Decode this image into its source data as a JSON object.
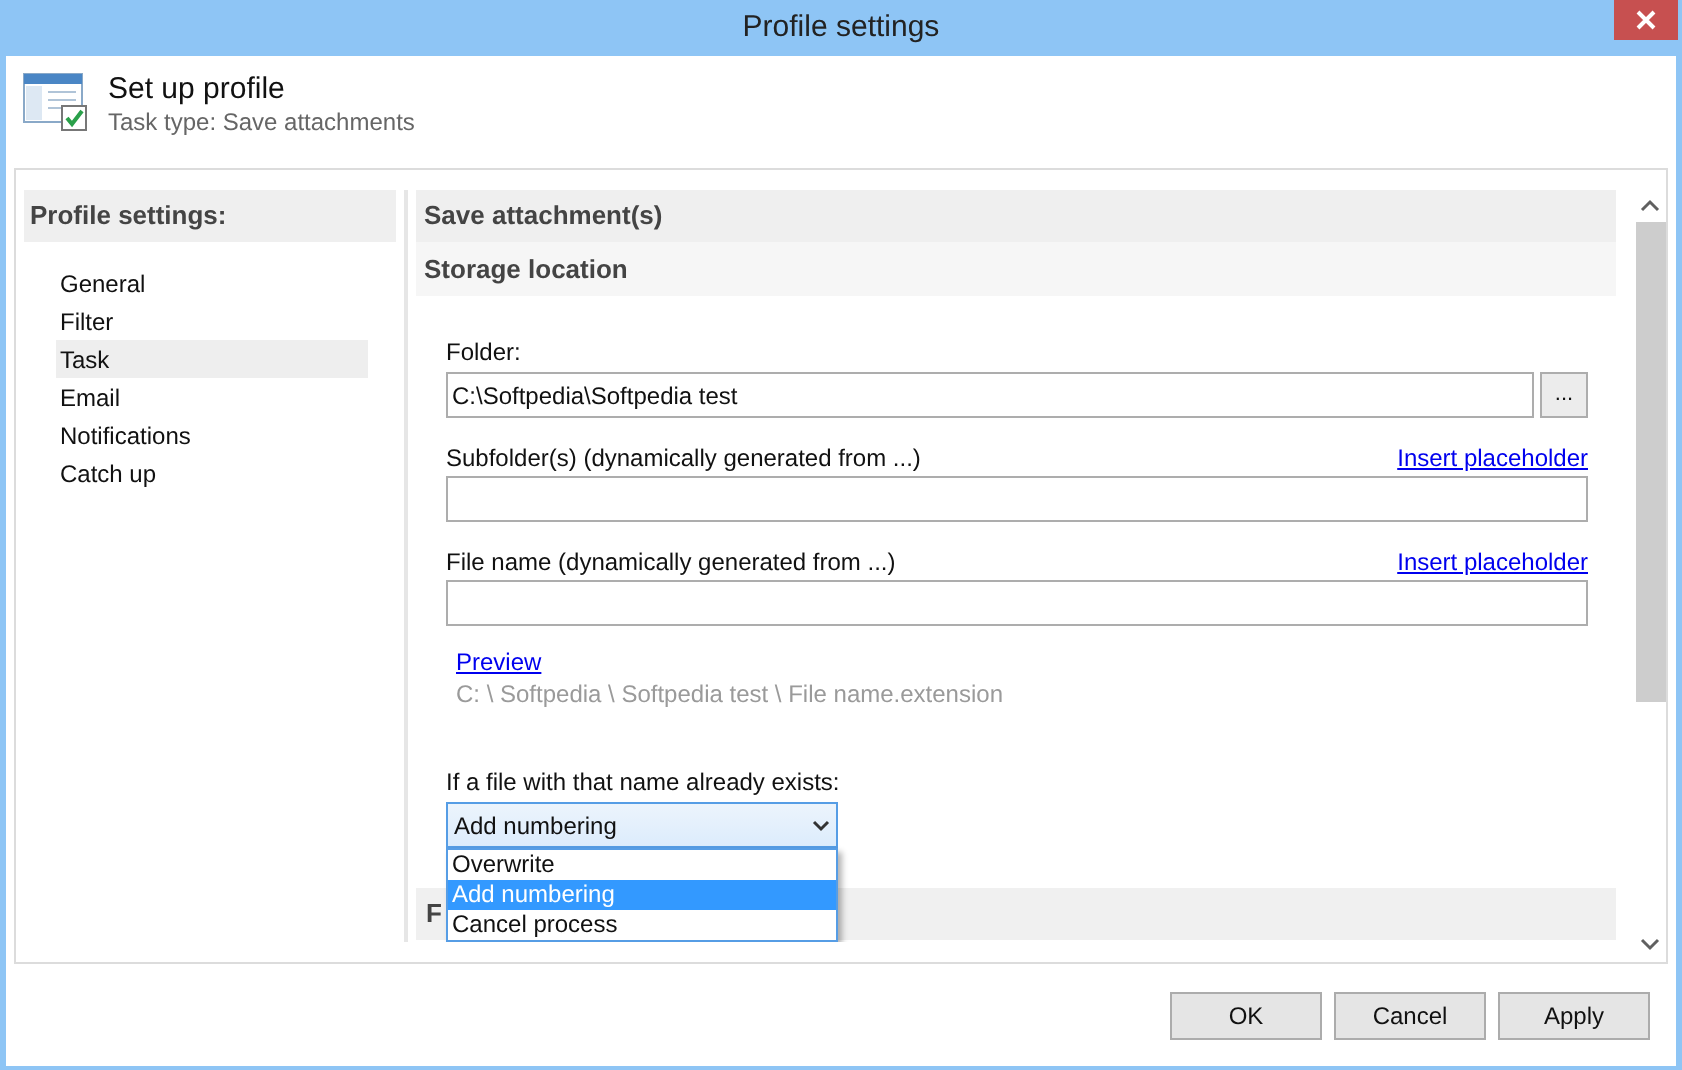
{
  "window": {
    "title": "Profile settings"
  },
  "header": {
    "title": "Set up profile",
    "subtitle": "Task type: Save attachments"
  },
  "sidebar": {
    "heading": "Profile settings:",
    "items": [
      {
        "label": "General",
        "selected": false
      },
      {
        "label": "Filter",
        "selected": false
      },
      {
        "label": "Task",
        "selected": true
      },
      {
        "label": "Email",
        "selected": false
      },
      {
        "label": "Notifications",
        "selected": false
      },
      {
        "label": "Catch up",
        "selected": false
      }
    ]
  },
  "content": {
    "heading": "Save attachment(s)",
    "section": "Storage location",
    "folder": {
      "label": "Folder:",
      "value": "C:\\Softpedia\\Softpedia test",
      "browse": "..."
    },
    "subfolder": {
      "label": "Subfolder(s) (dynamically generated from ...)",
      "link": "Insert placeholder"
    },
    "file_name": {
      "label": "File name (dynamically generated from ...)",
      "link": "Insert placeholder"
    },
    "preview": {
      "link": "Preview",
      "path": "C: \\ Softpedia \\ Softpedia test \\ File name.extension"
    },
    "exists": {
      "label": "If a file with that name already exists:",
      "value": "Add numbering",
      "expanded": true,
      "options": [
        {
          "label": "Overwrite",
          "selected": false
        },
        {
          "label": "Add numbering",
          "selected": true
        },
        {
          "label": "Cancel process",
          "selected": false
        }
      ]
    },
    "next_section": "F"
  },
  "buttons": [
    "OK",
    "Cancel",
    "Apply"
  ]
}
